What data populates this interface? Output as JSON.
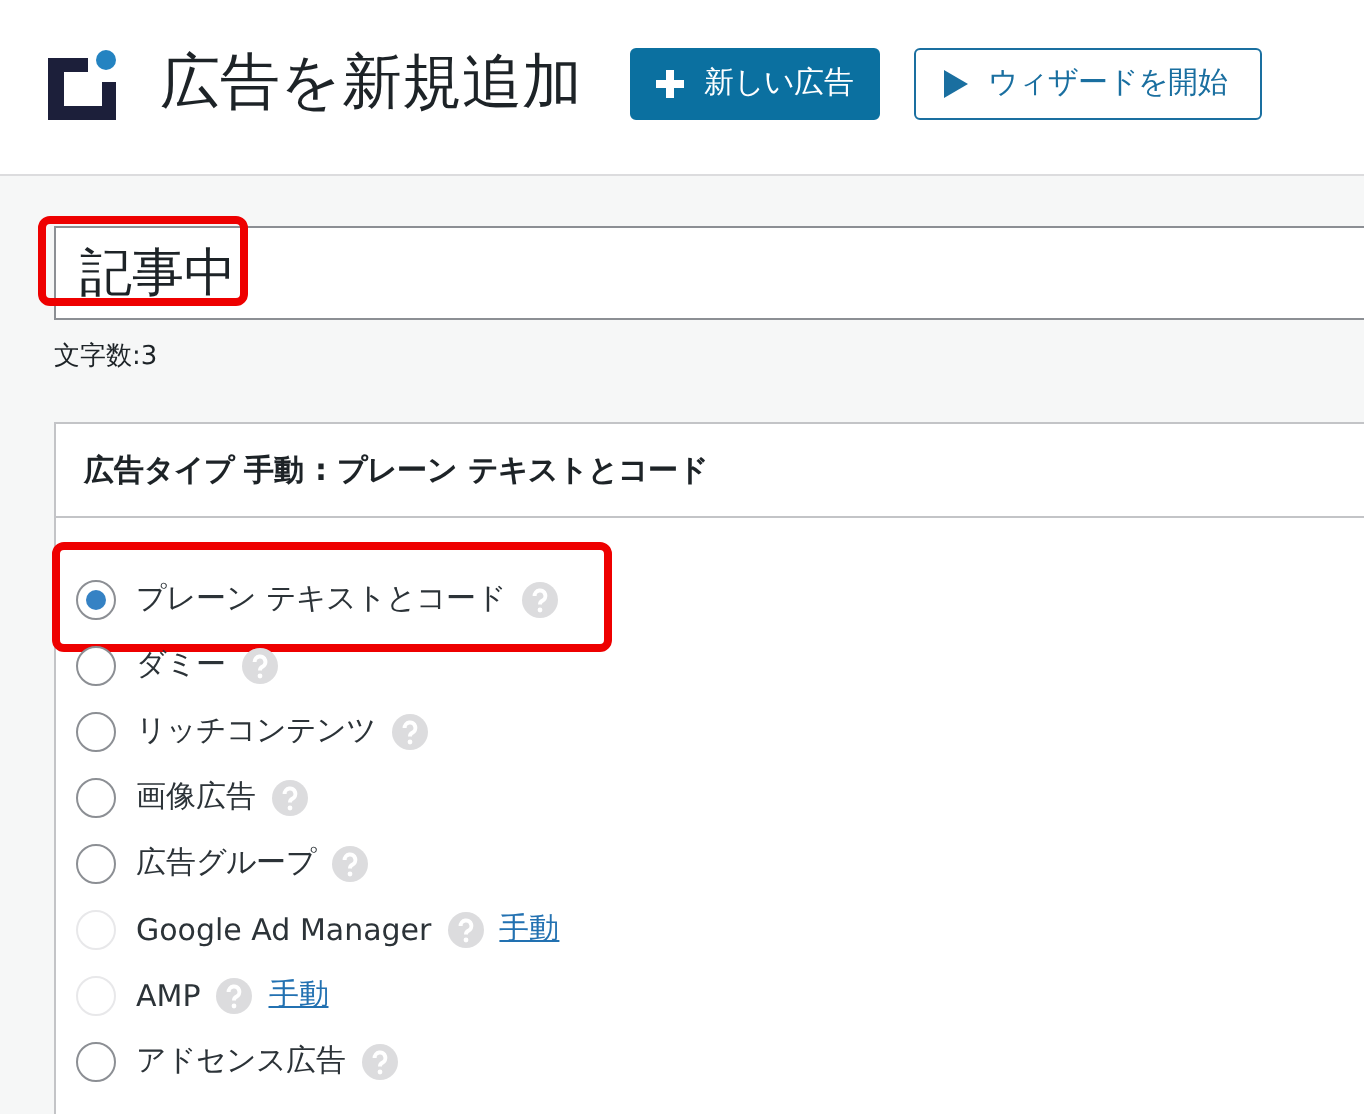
{
  "header": {
    "title": "広告を新規追加",
    "buttons": [
      {
        "kind": "primary",
        "label": "新しい広告"
      },
      {
        "kind": "secondary",
        "label": "ウィザードを開始"
      }
    ]
  },
  "title_field": {
    "value": "記事中",
    "highlighted": true
  },
  "char_count": "文字数:3",
  "ad_type_panel": {
    "title": "広告タイプ 手動 : プレーン テキストとコード",
    "options": [
      {
        "label": "プレーン テキストとコード",
        "selected": true,
        "disabled": false,
        "highlighted": true
      },
      {
        "label": "ダミー",
        "selected": false,
        "disabled": false,
        "highlighted": false
      },
      {
        "label": "リッチコンテンツ",
        "selected": false,
        "disabled": false,
        "highlighted": false
      },
      {
        "label": "画像広告",
        "selected": false,
        "disabled": false,
        "highlighted": false
      },
      {
        "label": "広告グループ",
        "selected": false,
        "disabled": false,
        "highlighted": false
      },
      {
        "label": "Google Ad Manager",
        "selected": false,
        "disabled": true,
        "highlighted": false,
        "link": "手動"
      },
      {
        "label": "AMP",
        "selected": false,
        "disabled": true,
        "highlighted": false,
        "link": "手動"
      },
      {
        "label": "アドセンス広告",
        "selected": false,
        "disabled": false,
        "highlighted": false
      }
    ]
  }
}
